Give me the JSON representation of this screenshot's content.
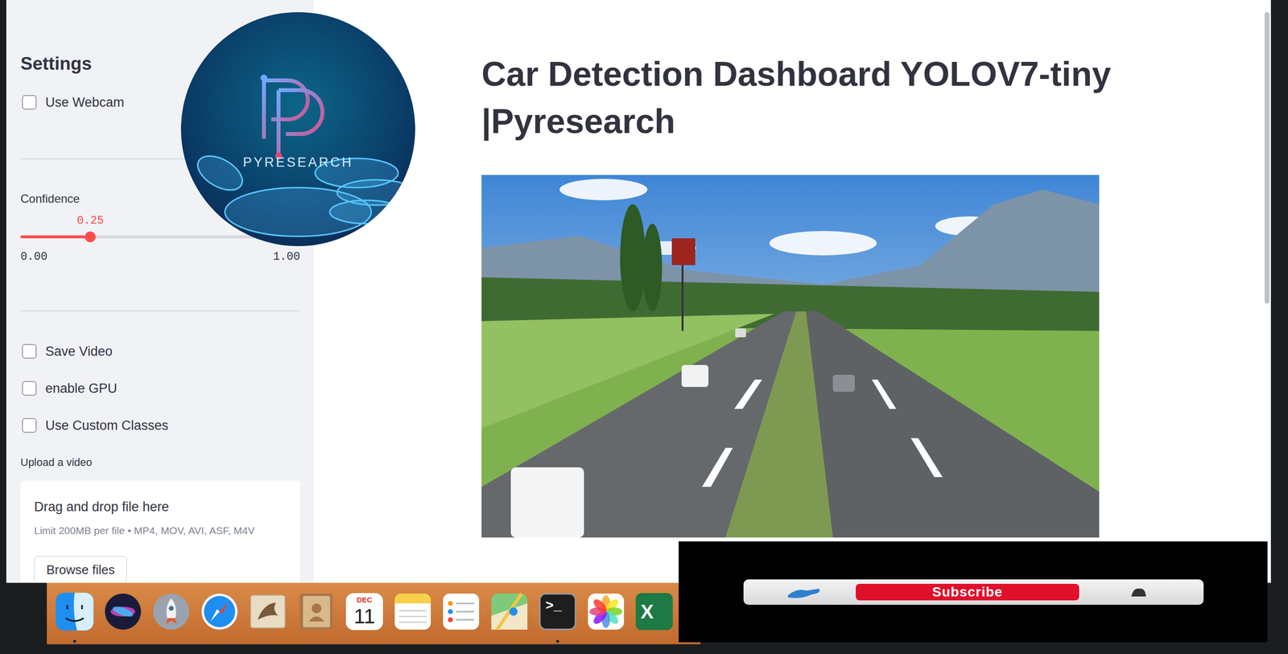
{
  "logo": {
    "text": "PYRESEARCH"
  },
  "sidebar": {
    "title": "Settings",
    "webcam": {
      "label": "Use Webcam",
      "checked": false
    },
    "confidence": {
      "label": "Confidence",
      "value": "0.25",
      "level": 0.25,
      "min": "0.00",
      "max": "1.00"
    },
    "options": [
      {
        "label": "Save Video",
        "checked": false
      },
      {
        "label": "enable GPU",
        "checked": false
      },
      {
        "label": "Use Custom Classes",
        "checked": false
      }
    ],
    "upload": {
      "label": "Upload a video",
      "dropzone": "Drag and drop file here",
      "limit": "Limit 200MB per file • MP4, MOV, AVI, ASF, M4V",
      "button": "Browse files"
    }
  },
  "main": {
    "title": "Car Detection Dashboard YOLOV7-tiny |Pyresearch"
  },
  "dock": {
    "items": [
      {
        "kind": "finder",
        "running": true
      },
      {
        "kind": "siri",
        "running": false
      },
      {
        "kind": "launchpad",
        "running": false
      },
      {
        "kind": "safari",
        "running": false
      },
      {
        "kind": "mail",
        "running": false
      },
      {
        "kind": "contacts",
        "running": false
      },
      {
        "kind": "calendar",
        "running": false,
        "month": "DEC",
        "day": "11"
      },
      {
        "kind": "notes",
        "running": false
      },
      {
        "kind": "reminders",
        "running": false
      },
      {
        "kind": "maps",
        "running": false
      },
      {
        "kind": "terminal",
        "running": true,
        "label": ">_"
      },
      {
        "kind": "photos",
        "running": false
      },
      {
        "kind": "excel",
        "running": false,
        "label": "X"
      }
    ]
  },
  "overlay": {
    "button": "Subscribe"
  }
}
